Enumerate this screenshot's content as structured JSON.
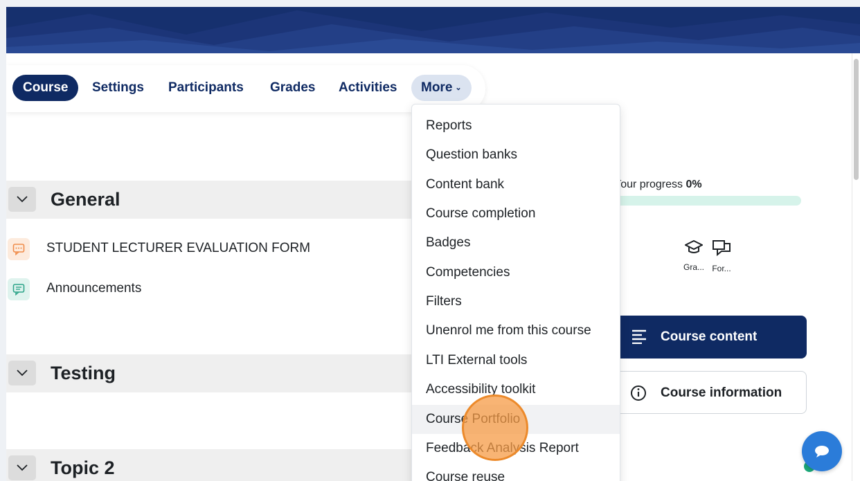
{
  "secondary_nav": {
    "items": [
      {
        "label": "Course",
        "active": true
      },
      {
        "label": "Settings"
      },
      {
        "label": "Participants"
      },
      {
        "label": "Grades"
      },
      {
        "label": "Activities"
      }
    ],
    "more_label": "More",
    "more_icon": "chevron-down-icon"
  },
  "more_menu": {
    "items": [
      "Reports",
      "Question banks",
      "Content bank",
      "Course completion",
      "Badges",
      "Competencies",
      "Filters",
      "Unenrol me from this course",
      "LTI External tools",
      "Accessibility toolkit",
      "Course Portfolio",
      "Feedback Analysis Report",
      "Course reuse"
    ],
    "hovered_item": "Course Portfolio"
  },
  "sections": [
    {
      "title": "General",
      "activities": [
        {
          "label": "STUDENT LECTURER EVALUATION FORM",
          "icon": "feedback-icon",
          "color": "#f08c4a"
        },
        {
          "label": "Announcements",
          "icon": "forum-icon",
          "color": "#2fa58a"
        }
      ]
    },
    {
      "title": "Testing",
      "activities": []
    },
    {
      "title": "Topic 2",
      "activities": []
    }
  ],
  "progress": {
    "label": "Your progress",
    "value_label": "0%",
    "value": 0
  },
  "quick_links": [
    {
      "label": "Gra...",
      "icon": "graduation-cap-icon"
    },
    {
      "label": "For...",
      "icon": "forum-icon"
    }
  ],
  "buttons": {
    "course_content": "Course content",
    "course_information": "Course information"
  },
  "colors": {
    "brand_navy": "#0f2a63",
    "banner": "#1c3578",
    "progress_track": "#d6f3ea",
    "chat": "#2b7cd9"
  }
}
